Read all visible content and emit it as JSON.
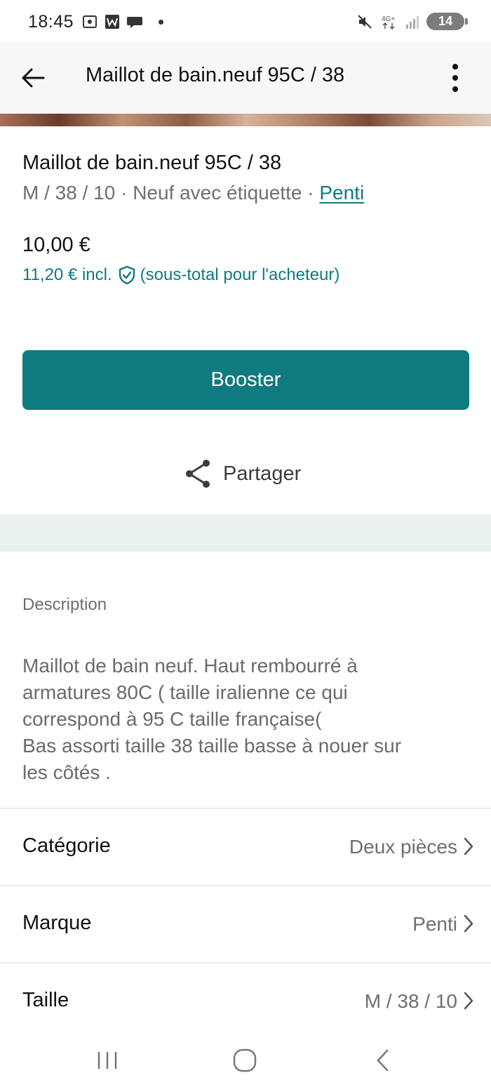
{
  "status_bar": {
    "time": "18:45",
    "left_icons": [
      "screenshot-icon",
      "w-app-icon",
      "chat-bubble-icon",
      "dot-icon"
    ],
    "right_icons": [
      "mute-icon",
      "network-4g-icon",
      "signal-icon"
    ],
    "battery": "14"
  },
  "app_bar": {
    "back_icon": "arrow-left-icon",
    "title": "Maillot de bain.neuf 95C / 38",
    "more_icon": "more-vertical-icon"
  },
  "item": {
    "title": "Maillot de bain.neuf 95C / 38",
    "size": "M / 38 / 10",
    "separator": " · ",
    "condition": "Neuf avec étiquette",
    "brand": "Penti",
    "price": "10,00 €",
    "price_with_protection": "11,20 €",
    "incl_label": "incl.",
    "protection_note": "(sous-total pour l'acheteur)"
  },
  "actions": {
    "booster_label": "Booster",
    "share_label": "Partager"
  },
  "description": {
    "label": "Description",
    "text": "Maillot de bain neuf. Haut rembourré à\narmatures 80C ( taille iralienne ce qui\ncorrespond à 95 C taille française(\nBas assorti taille 38 taille basse à nouer sur\nles côtés ."
  },
  "details": [
    {
      "label": "Catégorie",
      "value": "Deux pièces"
    },
    {
      "label": "Marque",
      "value": "Penti"
    },
    {
      "label": "Taille",
      "value": "M / 38 / 10"
    }
  ],
  "nav_bar": [
    "recent-apps-icon",
    "home-icon",
    "back-icon"
  ],
  "colors": {
    "accent": "#0f7a80",
    "section_gap": "#eaf1f1",
    "secondary_text": "#6f6f6f"
  }
}
